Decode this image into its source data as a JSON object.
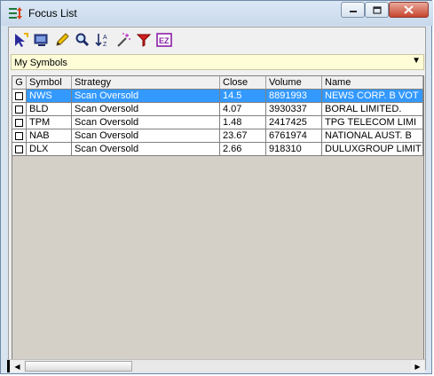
{
  "window": {
    "title": "Focus List",
    "icon": "focus-list-icon",
    "controls": [
      "minimize-icon",
      "maximize-icon",
      "close-icon"
    ]
  },
  "toolbar": {
    "buttons": [
      {
        "icon": "add-symbol-icon"
      },
      {
        "icon": "monitor-icon"
      },
      {
        "icon": "pencil-icon"
      },
      {
        "icon": "magnifier-icon"
      },
      {
        "icon": "sort-icon"
      },
      {
        "icon": "wand-icon"
      },
      {
        "icon": "filter-icon"
      },
      {
        "icon": "ez-icon",
        "text": "EZ"
      }
    ]
  },
  "list_selector": {
    "value": "My Symbols",
    "arrow": "▼"
  },
  "grid": {
    "columns": [
      "G",
      "Symbol",
      "Strategy",
      "Close",
      "Volume",
      "Name"
    ],
    "rows": [
      {
        "symbol": "NWS",
        "strategy": "Scan Oversold",
        "close": "14.5",
        "volume": "8891993",
        "name": "NEWS CORP. B VOT",
        "selected": true
      },
      {
        "symbol": "BLD",
        "strategy": "Scan Oversold",
        "close": "4.07",
        "volume": "3930337",
        "name": "BORAL LIMITED.",
        "selected": false
      },
      {
        "symbol": "TPM",
        "strategy": "Scan Oversold",
        "close": "1.48",
        "volume": "2417425",
        "name": "TPG TELECOM LIMI",
        "selected": false
      },
      {
        "symbol": "NAB",
        "strategy": "Scan Oversold",
        "close": "23.67",
        "volume": "6761974",
        "name": "NATIONAL AUST. B",
        "selected": false
      },
      {
        "symbol": "DLX",
        "strategy": "Scan Oversold",
        "close": "2.66",
        "volume": "918310",
        "name": "DULUXGROUP LIMIT",
        "selected": false
      }
    ]
  },
  "scrollbar": {
    "left_arrow": "◀",
    "right_arrow": "▶"
  },
  "colors": {
    "selection": "#3399ff",
    "list_selector_bg": "#fffdd8",
    "grid_empty_bg": "#d4d0c8"
  }
}
